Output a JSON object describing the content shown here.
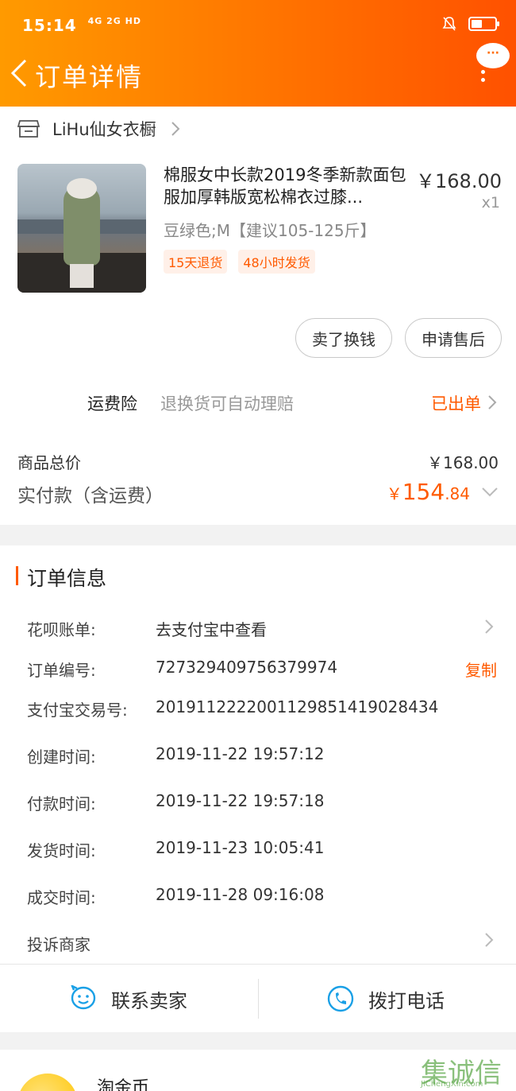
{
  "status_bar": {
    "time": "15:14",
    "signal": "4G 2G HD"
  },
  "header": {
    "title": "订单详情",
    "bubble": "···"
  },
  "shop": {
    "name": "LiHu仙女衣橱"
  },
  "product": {
    "title": "棉服女中长款2019冬季新款面包服加厚韩版宽松棉衣过膝...",
    "price": "￥168.00",
    "qty": "x1",
    "spec": "豆绿色;M【建议105-125斤】",
    "tags": [
      "15天退货",
      "48小时发货"
    ]
  },
  "actions": {
    "sell": "卖了换钱",
    "after_sale": "申请售后"
  },
  "insurance": {
    "label": "运费险",
    "desc": "退换货可自动理赔",
    "status": "已出单"
  },
  "summary": {
    "total_label": "商品总价",
    "total_value": "￥168.00",
    "paid_label": "实付款（含运费）",
    "paid_currency": "￥",
    "paid_int": "154",
    "paid_dec": ".84"
  },
  "order_info": {
    "title": "订单信息",
    "huabei_label": "花呗账单:",
    "huabei_value": "去支付宝中查看",
    "order_no_label": "订单编号:",
    "order_no": "727329409756379974",
    "copy": "复制",
    "alipay_label": "支付宝交易号:",
    "alipay_no": "2019112222001129851419028434",
    "created_label": "创建时间:",
    "created": "2019-11-22 19:57:12",
    "paid_label": "付款时间:",
    "paid": "2019-11-22 19:57:18",
    "shipped_label": "发货时间:",
    "shipped": "2019-11-23 10:05:41",
    "deal_label": "成交时间:",
    "deal": "2019-11-28 09:16:08",
    "complain": "投诉商家"
  },
  "contact": {
    "seller": "联系卖家",
    "call": "拨打电话"
  },
  "bottom": {
    "coin_label": "淘金币",
    "watermark": "集诚信",
    "watermark_sub": "JiChengXin.com"
  },
  "colors": {
    "accent": "#ff5a00",
    "header_start": "#ff9a00",
    "header_end": "#ff5100",
    "icon_blue": "#1aa0e6"
  }
}
